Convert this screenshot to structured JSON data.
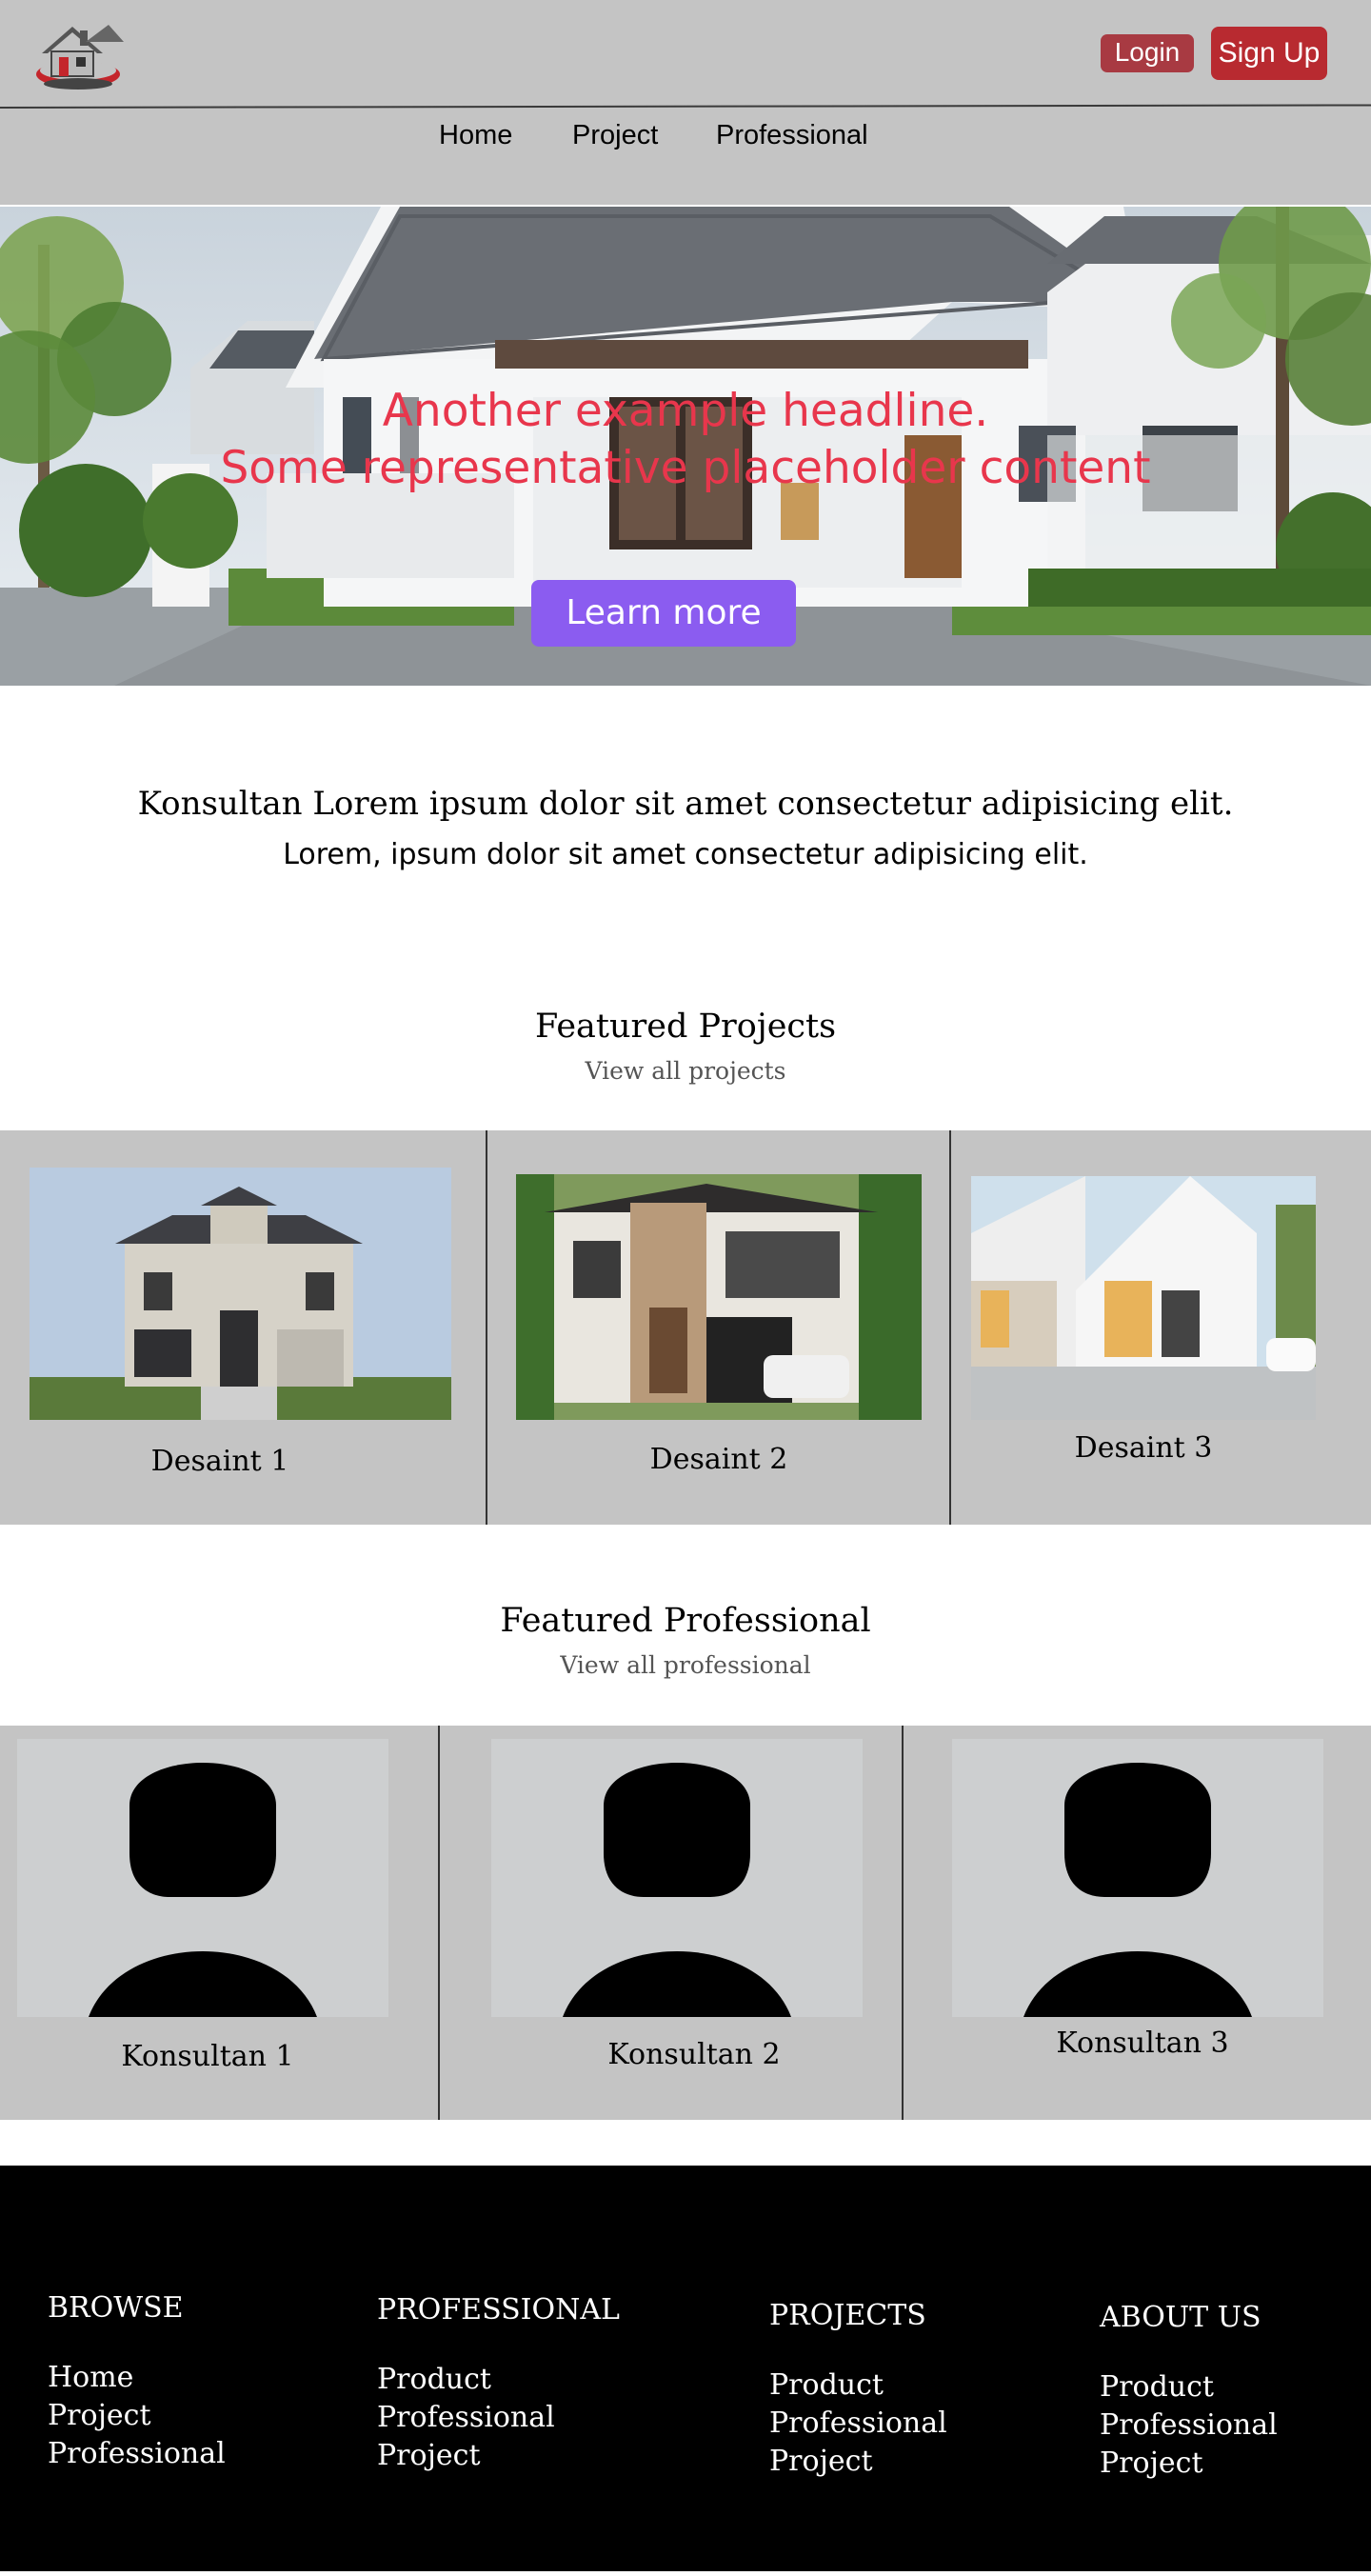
{
  "header": {
    "login_label": "Login",
    "signup_label": "Sign Up",
    "nav": [
      "Home",
      "Project",
      "Professional"
    ]
  },
  "hero": {
    "headline_1": "Another  example  headline.",
    "headline_2": "Some representative placeholder content",
    "button_label": "Learn more"
  },
  "intro": {
    "title": "Konsultan Lorem ipsum dolor sit amet consectetur adipisicing elit.",
    "subtitle": "Lorem, ipsum dolor sit amet consectetur adipisicing elit."
  },
  "projects": {
    "title": "Featured Projects",
    "link": "View all projects",
    "items": [
      "Desaint 1",
      "Desaint 2",
      "Desaint 3"
    ]
  },
  "professionals": {
    "title": "Featured Professional",
    "link": "View all  professional",
    "items": [
      "Konsultan 1",
      "Konsultan 2",
      "Konsultan 3"
    ]
  },
  "footer": {
    "columns": [
      {
        "heading": "BROWSE",
        "links": [
          "Home",
          "Project",
          "Professional"
        ]
      },
      {
        "heading": "PROFESSIONAL",
        "links": [
          "Product",
          "Professional",
          "Project"
        ]
      },
      {
        "heading": "PROJECTS",
        "links": [
          "Product",
          "Professional",
          "Project"
        ]
      },
      {
        "heading": "ABOUT US",
        "links": [
          "Product",
          "Professional",
          "Project"
        ]
      }
    ]
  },
  "colors": {
    "header_bg": "#c4c4c4",
    "login_bg": "#a83a42",
    "signup_bg": "#b82a30",
    "hero_text": "#e8364c",
    "hero_button": "#8b5cf0",
    "footer_bg": "#000000"
  },
  "icons": [
    "house-logo-icon",
    "person-silhouette-icon"
  ]
}
